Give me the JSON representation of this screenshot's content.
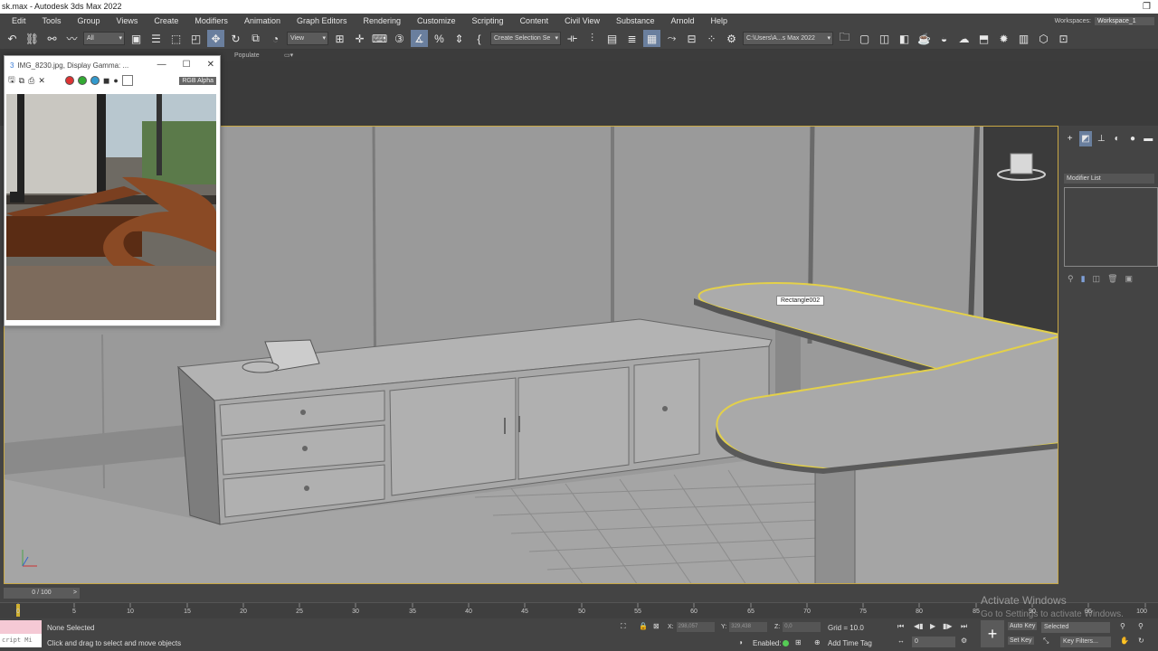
{
  "window": {
    "title": "sk.max - Autodesk 3ds Max 2022",
    "restore_icon": "restore-icon"
  },
  "menu": [
    "Edit",
    "Tools",
    "Group",
    "Views",
    "Create",
    "Modifiers",
    "Animation",
    "Graph Editors",
    "Rendering",
    "Customize",
    "Scripting",
    "Content",
    "Civil View",
    "Substance",
    "Arnold",
    "Help"
  ],
  "workspace": {
    "label": "Workspaces:",
    "value": "Workspace_1"
  },
  "toolbar": {
    "filter": "All",
    "ref_coord": "View",
    "selection_set": "Create Selection Se",
    "project_path": "C:\\Users\\A...s Max 2022"
  },
  "ribbon": {
    "populate": "Populate"
  },
  "image_window": {
    "title": "IMG_8230.jpg, Display Gamma: ...",
    "channel": "RGB Alpha",
    "minimize": "—",
    "maximize": "☐",
    "close": "✕"
  },
  "viewport": {
    "object_label": "Rectangle002"
  },
  "command_panel": {
    "modifier_list": "Modifier List"
  },
  "time": {
    "frame_counter": "0 / 100",
    "ticks": [
      0,
      5,
      10,
      15,
      20,
      25,
      30,
      35,
      40,
      45,
      50,
      55,
      60,
      65,
      70,
      75,
      80,
      85,
      90,
      95,
      100
    ]
  },
  "status": {
    "maxscript": "cript Mi",
    "selection": "None Selected",
    "prompt": "Click and drag to select and move objects",
    "x_label": "X:",
    "x_value": "298,057",
    "y_label": "Y:",
    "y_value": "329,438",
    "z_label": "Z:",
    "z_value": "0,0",
    "grid": "Grid = 10.0",
    "enabled": "Enabled:",
    "add_time_tag": "Add Time Tag",
    "auto_key": "Auto Key",
    "set_key": "Set Key",
    "selected": "Selected",
    "key_filters": "Key Filters...",
    "frame_field": "0"
  },
  "watermark": {
    "line1": "Activate Windows",
    "line2": "Go to Settings to activate Windows."
  }
}
